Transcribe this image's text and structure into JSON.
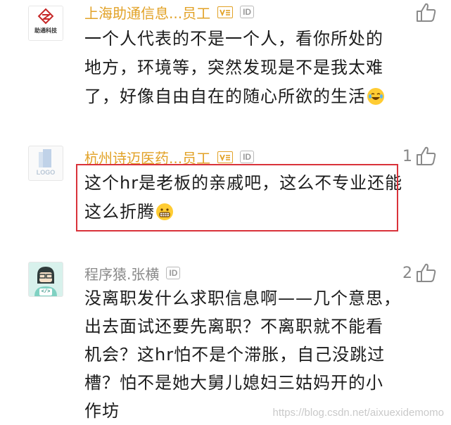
{
  "comments": [
    {
      "author": "上海助通信息...员工",
      "id_badge": "ID",
      "avatar_text": "助通科技",
      "lines": [
        "一个人代表的不是一个人，看你所处的",
        "地方，环境等，突然发现是不是我太难",
        "了，好像自由自在的随心所欲的生活"
      ],
      "likes": ""
    },
    {
      "author": "杭州诗迈医药...员工",
      "id_badge": "ID",
      "avatar_text": "LOGO",
      "lines": [
        "这个hr是老板的亲戚吧，这么不专业还能",
        "这么折腾"
      ],
      "likes": "1"
    },
    {
      "author": "程序猿.张横",
      "id_badge": "ID",
      "avatar_text": "</>",
      "lines": [
        "没离职发什么求职信息啊——几个意思，",
        "出去面试还要先离职？不离职就不能看",
        "机会？这hr怕不是个滞胀，自己没跳过",
        "槽？怕不是她大舅儿媳妇三姑妈开的小",
        "作坊"
      ],
      "likes": "2"
    }
  ],
  "watermark": "https://blog.csdn.net/aixuexidemomo",
  "colors": {
    "company_name": "#e2a227",
    "plain_name": "#8a8a8a",
    "highlight": "#d9323a",
    "emoji": "#ffcc33"
  },
  "icons": [
    "thumbs-up-icon",
    "verified-badge-icon",
    "laughing-emoji-icon",
    "grinning-emoji-icon"
  ]
}
